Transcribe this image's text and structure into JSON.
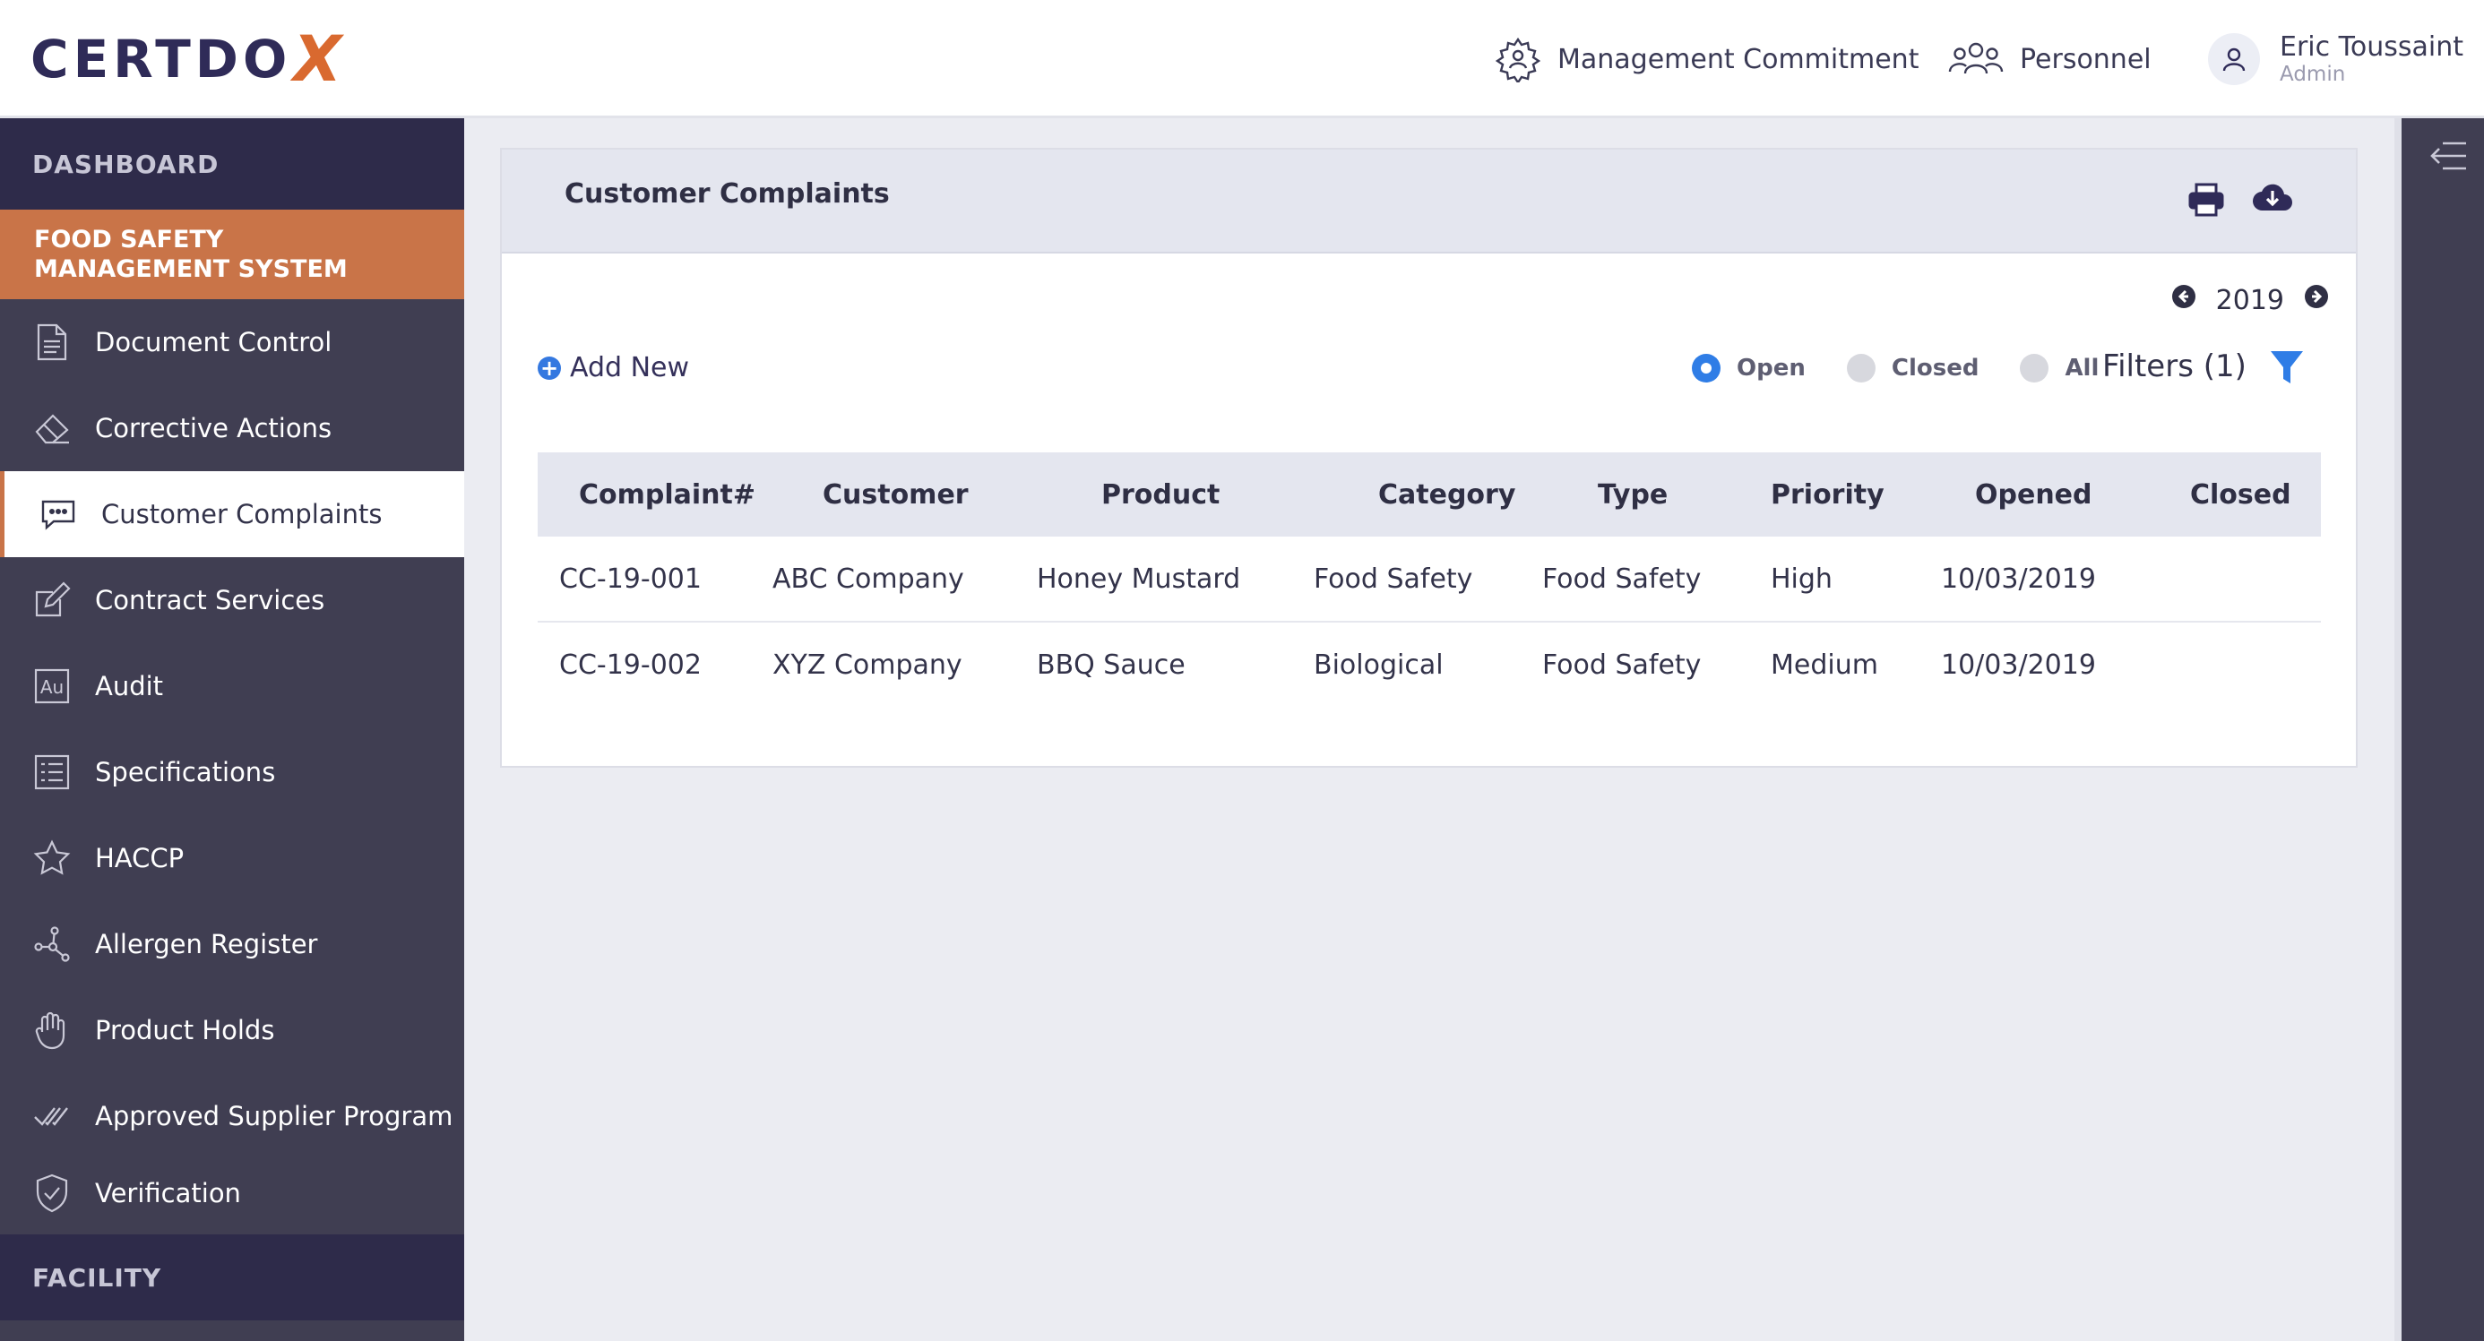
{
  "topbar": {
    "brand_text": "CERTDO",
    "brand_x": "X",
    "nav": [
      {
        "label": "Management Commitment",
        "icon": "gear-person-icon"
      },
      {
        "label": "Personnel",
        "icon": "people-icon"
      }
    ],
    "user": {
      "name": "Eric Toussaint",
      "role": "Admin",
      "icon": "user-icon"
    }
  },
  "sidebar": {
    "dashboard_label": "DASHBOARD",
    "group_title_line1": "FOOD SAFETY",
    "group_title_line2": "MANAGEMENT SYSTEM",
    "items": [
      {
        "label": "Document Control",
        "icon": "document-icon"
      },
      {
        "label": "Corrective Actions",
        "icon": "eraser-icon"
      },
      {
        "label": "Customer Complaints",
        "icon": "chat-icon",
        "selected": true
      },
      {
        "label": "Contract Services",
        "icon": "edit-icon"
      },
      {
        "label": "Audit",
        "icon": "au-icon",
        "glyph": "Au"
      },
      {
        "label": "Specifications",
        "icon": "list-icon"
      },
      {
        "label": "HACCP",
        "icon": "star-icon"
      },
      {
        "label": "Allergen Register",
        "icon": "molecule-icon"
      },
      {
        "label": "Product Holds",
        "icon": "hand-icon"
      },
      {
        "label": "Approved Supplier Program",
        "icon": "double-check-icon"
      },
      {
        "label": "Verification",
        "icon": "shield-check-icon"
      }
    ],
    "facility_label": "FACILITY"
  },
  "card": {
    "title": "Customer Complaints",
    "print_icon": "print-icon",
    "download_icon": "cloud-download-icon",
    "year": "2019",
    "add_new_label": "Add New",
    "radios": [
      {
        "label": "Open",
        "checked": true
      },
      {
        "label": "Closed",
        "checked": false
      },
      {
        "label": "All",
        "checked": false
      }
    ],
    "filters_label": "Filters (1)",
    "accent": "#2f7de6"
  },
  "table": {
    "columns": [
      "Complaint#",
      "Customer",
      "Product",
      "Category",
      "Type",
      "Priority",
      "Opened",
      "Closed"
    ],
    "rows": [
      [
        "CC-19-001",
        "ABC Company",
        "Honey Mustard",
        "Food Safety",
        "Food Safety",
        "High",
        "10/03/2019",
        ""
      ],
      [
        "CC-19-002",
        "XYZ Company",
        "BBQ Sauce",
        "Biological",
        "Food Safety",
        "Medium",
        "10/03/2019",
        ""
      ]
    ]
  },
  "colors": {
    "sidebar_bg": "#403e52",
    "sidebar_section_bg": "#2e2b4a",
    "active_group_bg": "#c97448",
    "brand_dark": "#2f2b58",
    "brand_orange": "#d9692f"
  }
}
